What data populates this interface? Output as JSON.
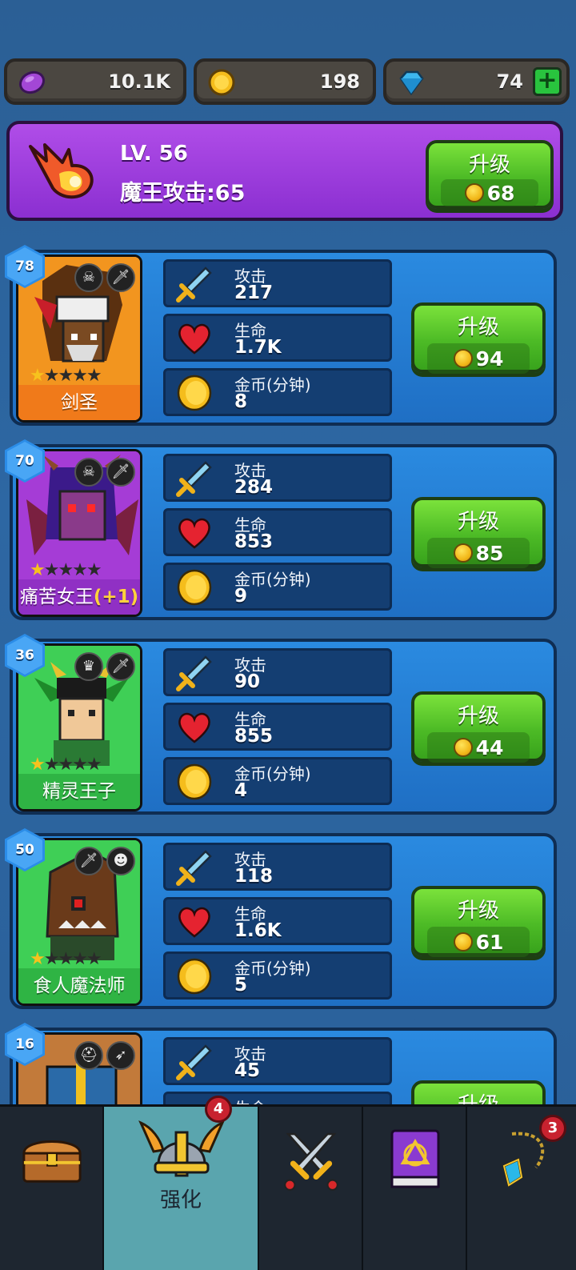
{
  "resources": {
    "purple": {
      "value": "10.1K",
      "icon": "purple-gem-icon"
    },
    "gold": {
      "value": "198",
      "icon": "gold-coin-icon"
    },
    "diamond": {
      "value": "74",
      "icon": "diamond-icon",
      "add": "+"
    }
  },
  "boss": {
    "level": "LV. 56",
    "attack": "魔王攻击:65",
    "upgrade_label": "升级",
    "upgrade_cost": "68"
  },
  "heroes": [
    {
      "level": "78",
      "name": "剑圣",
      "stars": 1,
      "attack_label": "攻击",
      "attack": "217",
      "hp_label": "生命",
      "hp": "1.7K",
      "gold_label": "金币(分钟)",
      "gold": "8",
      "upgrade_label": "升级",
      "upgrade_cost": "94",
      "bg": "#f2951f",
      "name_bg": "#f07a1a"
    },
    {
      "level": "70",
      "name": "痛苦女王",
      "name_bonus": "(+1)",
      "stars": 1,
      "attack_label": "攻击",
      "attack": "284",
      "hp_label": "生命",
      "hp": "853",
      "gold_label": "金币(分钟)",
      "gold": "9",
      "upgrade_label": "升级",
      "upgrade_cost": "85",
      "bg": "#a53cd6",
      "name_bg": "#9030c4"
    },
    {
      "level": "36",
      "name": "精灵王子",
      "stars": 1,
      "attack_label": "攻击",
      "attack": "90",
      "hp_label": "生命",
      "hp": "855",
      "gold_label": "金币(分钟)",
      "gold": "4",
      "upgrade_label": "升级",
      "upgrade_cost": "44",
      "bg": "#3fcf56",
      "name_bg": "#2fb444"
    },
    {
      "level": "50",
      "name": "食人魔法师",
      "stars": 1,
      "attack_label": "攻击",
      "attack": "118",
      "hp_label": "生命",
      "hp": "1.6K",
      "gold_label": "金币(分钟)",
      "gold": "5",
      "upgrade_label": "升级",
      "upgrade_cost": "61",
      "bg": "#3fcf56",
      "name_bg": "#2fb444"
    },
    {
      "level": "16",
      "attack_label": "攻击",
      "attack": "45",
      "hp_label": "生命",
      "upgrade_label": "升级"
    }
  ],
  "nav": {
    "tabs": [
      {
        "icon": "treasure-chest-icon"
      },
      {
        "icon": "viking-helmet-icon",
        "label": "强化",
        "badge": "4",
        "active": true
      },
      {
        "icon": "crossed-swords-icon"
      },
      {
        "icon": "spellbook-icon"
      },
      {
        "icon": "amulet-icon",
        "badge": "3"
      }
    ]
  }
}
